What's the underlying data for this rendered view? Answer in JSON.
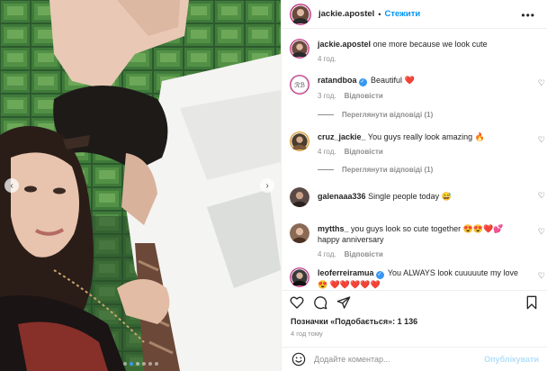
{
  "post": {
    "author": "jackie.apostel",
    "separator": "•",
    "follow_label": "Стежити",
    "more_label": "•••",
    "caption_text": "one more because we look cute",
    "caption_time": "4 год.",
    "likes_text": "Позначки «Подобається»: 1 136",
    "time_ago": "4 год тому",
    "carousel_dots": 6,
    "carousel_active": 1
  },
  "comments": [
    {
      "user": "ratandboa",
      "verified": true,
      "text": "Beautiful ❤️",
      "time": "3 год.",
      "reply_label": "Відповісти",
      "view_replies": "Переглянути відповіді (1)"
    },
    {
      "user": "cruz_jackie_",
      "verified": false,
      "text": "You guys really look amazing 🔥",
      "time": "4 год.",
      "reply_label": "Відповісти",
      "view_replies": "Переглянути відповіді (1)"
    },
    {
      "user": "galenaaa336",
      "verified": false,
      "text": "Single people today 😅",
      "time": "",
      "reply_label": "",
      "view_replies": ""
    },
    {
      "user": "mytths_",
      "verified": false,
      "text": "you guys look so cute together 😍😍❤️💕 happy anniversary",
      "time": "4 год.",
      "reply_label": "Відповісти",
      "view_replies": ""
    },
    {
      "user": "leoferreiramua",
      "verified": true,
      "text": "You ALWAYS look cuuuuute my love 😍 ❤️❤️❤️❤️❤️",
      "time": "",
      "reply_label": "",
      "view_replies": ""
    }
  ],
  "composer": {
    "placeholder": "Додайте коментар...",
    "post_label": "Опублікувати"
  },
  "icons": {
    "like": "heart-icon",
    "comment": "comment-icon",
    "share": "share-icon",
    "save": "bookmark-icon",
    "emoji": "emoji-icon",
    "prev": "chevron-left-icon",
    "next": "chevron-right-icon"
  },
  "colors": {
    "link": "#0095f6",
    "verified": "#3897f0",
    "muted": "#8e8e8e",
    "post_disabled": "#b2dffc"
  }
}
